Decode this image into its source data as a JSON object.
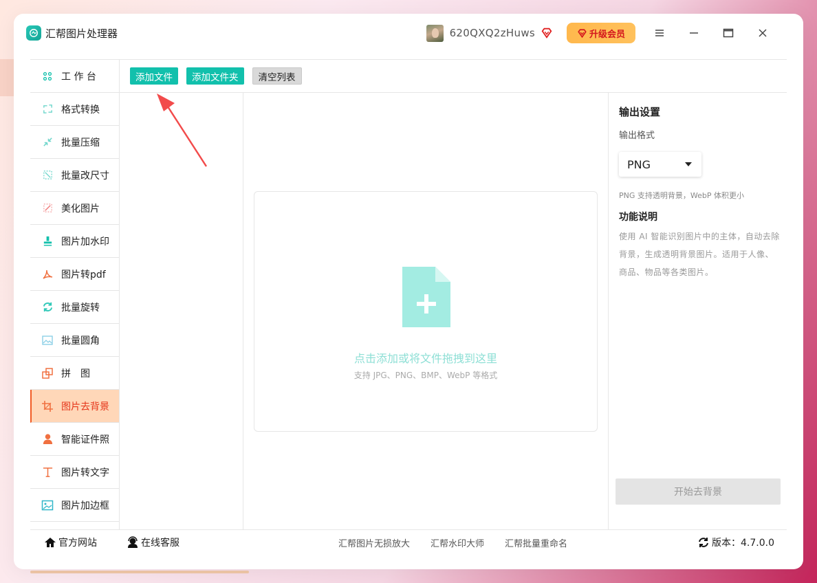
{
  "window": {
    "app_title": "汇帮图片处理器",
    "username": "620QXQ2zHuws",
    "upgrade_label": "升级会员"
  },
  "sidebar": {
    "items": [
      {
        "label": "工 作 台",
        "icon": "grid-icon",
        "active": false
      },
      {
        "label": "格式转换",
        "icon": "convert-icon",
        "active": false
      },
      {
        "label": "批量压缩",
        "icon": "compress-icon",
        "active": false
      },
      {
        "label": "批量改尺寸",
        "icon": "resize-icon",
        "active": false
      },
      {
        "label": "美化图片",
        "icon": "beautify-icon",
        "active": false
      },
      {
        "label": "图片加水印",
        "icon": "stamp-icon",
        "active": false
      },
      {
        "label": "图片转pdf",
        "icon": "pdf-icon",
        "active": false
      },
      {
        "label": "批量旋转",
        "icon": "rotate-icon",
        "active": false
      },
      {
        "label": "批量圆角",
        "icon": "image-icon",
        "active": false
      },
      {
        "label": "拼　图",
        "icon": "puzzle-icon",
        "active": false
      },
      {
        "label": "图片去背景",
        "icon": "crop-icon",
        "active": true
      },
      {
        "label": "智能证件照",
        "icon": "person-icon",
        "active": false
      },
      {
        "label": "图片转文字",
        "icon": "text-icon",
        "active": false
      },
      {
        "label": "图片加边框",
        "icon": "frame-icon",
        "active": false
      }
    ]
  },
  "toolbar": {
    "add_file": "添加文件",
    "add_folder": "添加文件夹",
    "clear_list": "清空列表"
  },
  "dropzone": {
    "title": "点击添加或将文件拖拽到这里",
    "subtitle": "支持 JPG、PNG、BMP、WebP 等格式"
  },
  "settings": {
    "title": "输出设置",
    "format_label": "输出格式",
    "format_value": "PNG",
    "format_hint": "PNG 支持透明背景，WebP 体积更小",
    "func_title": "功能说明",
    "func_desc": "使用 AI 智能识别图片中的主体，自动去除背景，生成透明背景图片。适用于人像、商品、物品等各类图片。",
    "start_button": "开始去背景"
  },
  "footer": {
    "official_site": "官方网站",
    "online_service": "在线客服",
    "links": [
      "汇帮图片无损放大",
      "汇帮水印大师",
      "汇帮批量重命名"
    ],
    "version": "版本：4.7.0.0"
  },
  "colors": {
    "accent": "#12c0ac",
    "active_bg": "#ffd7b8",
    "active_text": "#e53519",
    "vip": "#ffb84d"
  }
}
